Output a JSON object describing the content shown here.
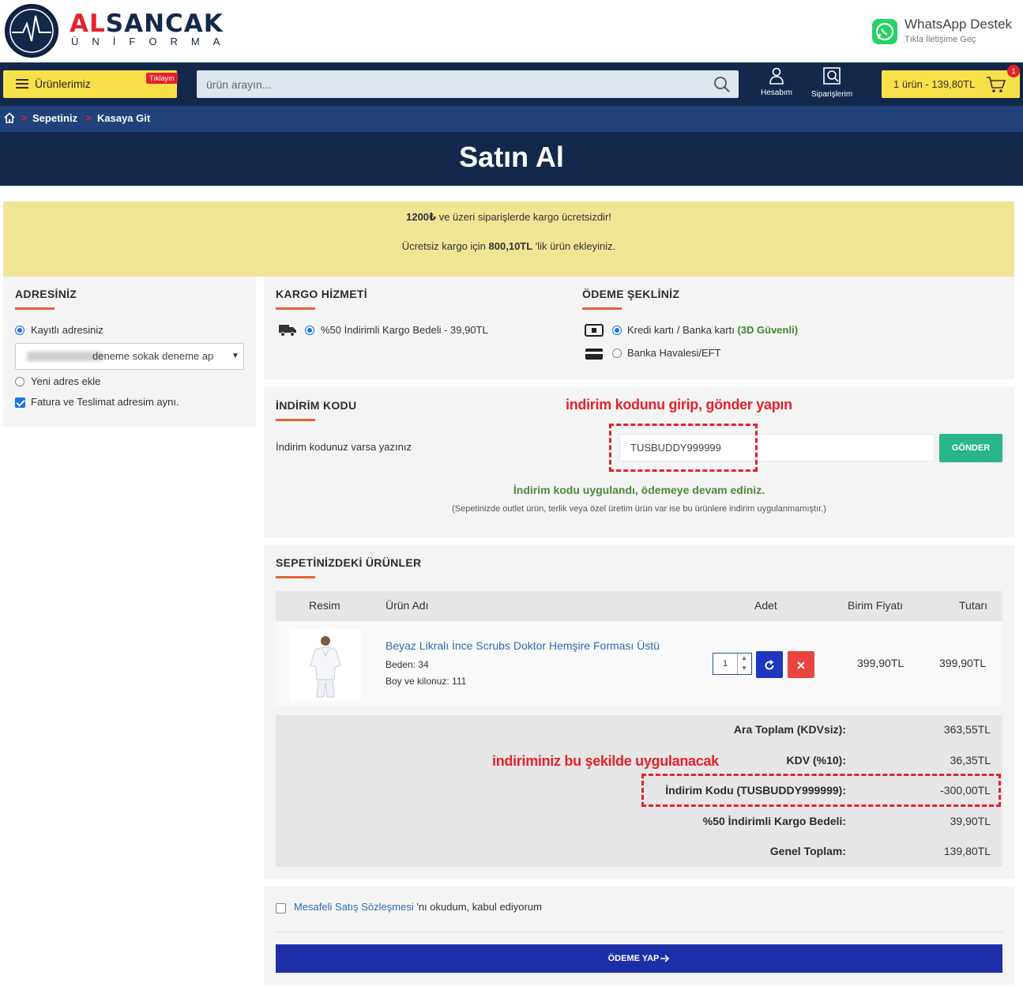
{
  "brand": {
    "name_red": "AL",
    "name_rest": "SANCAK",
    "sub": "ÜNİFORMA"
  },
  "whatsapp": {
    "title": "WhatsApp Destek",
    "subtitle": "Tıkla İletişime Geç"
  },
  "nav": {
    "products_label": "Ürünlerimiz",
    "products_badge": "Tıklayın",
    "search_placeholder": "ürün arayın...",
    "account_label": "Hesabım",
    "orders_label": "Siparişlerim",
    "cart_label": "1 ürün - 139,80TL",
    "cart_count": "1"
  },
  "breadcrumb": {
    "sep": ">",
    "items": [
      "Sepetiniz",
      "Kasaya Git"
    ]
  },
  "page_title": "Satın Al",
  "notice": {
    "line1_bold": "1200₺",
    "line1_rest": " ve üzeri siparişlerde kargo ücretsizdir!",
    "line2_pre": "Ücretsiz kargo için ",
    "line2_bold": "800,10TL",
    "line2_post": " 'lik ürün ekleyiniz."
  },
  "address": {
    "title": "ADRESİNİZ",
    "saved_label": "Kayıtlı adresiniz",
    "select_value": "deneme sokak deneme ap",
    "new_label": "Yeni adres ekle",
    "same_label": "Fatura ve Teslimat adresim aynı."
  },
  "shipping": {
    "title": "KARGO HİZMETİ",
    "option": "%50 İndirimli Kargo Bedeli - 39,90TL"
  },
  "payment": {
    "title": "ÖDEME ŞEKLİNİZ",
    "card_label": "Kredi kartı / Banka kartı",
    "card_secure": "(3D Güvenli)",
    "transfer_label": "Banka Havalesi/EFT"
  },
  "discount": {
    "title": "İNDİRİM KODU",
    "prompt": "İndirim kodunuz varsa yazınız",
    "code": "TUSBUDDY999999",
    "send_label": "GÖNDER",
    "annotation": "indirim kodunu girip, gönder yapın",
    "success": "İndirim kodu uygulandı, ödemeye devam ediniz.",
    "note": "(Sepetinizde outlet ürün, terlik veya özel üretim ürün var ise bu ürünlere indirim uygulanmamıştır.)"
  },
  "cart": {
    "title": "SEPETİNİZDEKİ ÜRÜNLER",
    "columns": [
      "Resim",
      "Ürün Adı",
      "Adet",
      "Birim Fiyatı",
      "Tutarı"
    ],
    "item": {
      "name": "Beyaz Likralı İnce Scrubs Doktor Hemşire Forması Üstü",
      "size": "Beden: 34",
      "height_weight": "Boy ve kilonuz: 111",
      "qty": "1",
      "unit_price": "399,90TL",
      "total": "399,90TL"
    }
  },
  "totals": {
    "annotation": "indiriminiz bu şekilde uygulanacak",
    "rows": [
      {
        "label": "Ara Toplam (KDVsiz):",
        "value": "363,55TL"
      },
      {
        "label": "KDV (%10):",
        "value": "36,35TL"
      },
      {
        "label": "İndirim Kodu (TUSBUDDY999999):",
        "value": "-300,00TL"
      },
      {
        "label": "%50 İndirimli Kargo Bedeli:",
        "value": "39,90TL"
      },
      {
        "label": "Genel Toplam:",
        "value": "139,80TL"
      }
    ]
  },
  "agreement": {
    "link": "Mesafeli Satış Sözleşmesi",
    "rest": " 'nı okudum, kabul ediyorum"
  },
  "pay_label": "ÖDEME YAP",
  "colors": {
    "navy": "#14284b",
    "accent_red": "#e5222b",
    "yellow": "#f8e04a",
    "green": "#2bb58a",
    "pay_blue": "#1d2fa8"
  }
}
